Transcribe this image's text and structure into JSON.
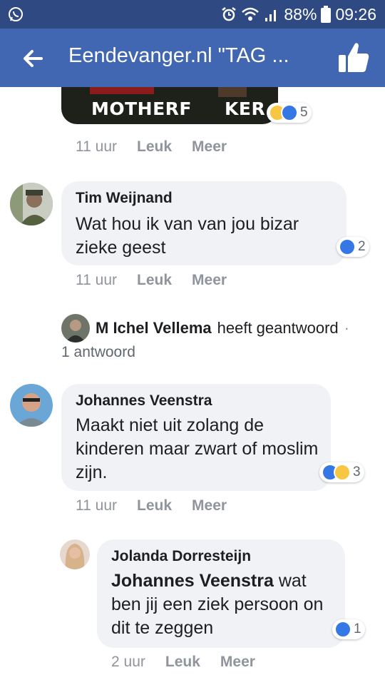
{
  "status_bar": {
    "battery": "88%",
    "time": "09:26",
    "icons": [
      "whatsapp-icon",
      "alarm-icon",
      "wifi-icon",
      "signal-icon",
      "battery-icon"
    ]
  },
  "header": {
    "title": "Eendevanger.nl \"TAG ...",
    "icons": [
      "back-arrow-icon",
      "like-page-icon"
    ]
  },
  "colors": {
    "header_bg": "#4267b2",
    "status_bg": "#2f4a82",
    "bubble_bg": "#f0f2f5",
    "like_blue": "#3578e5"
  },
  "gif": {
    "text": "MOTHERF     KER.",
    "reactions": {
      "icons": [
        "haha-icon",
        "like-icon"
      ],
      "count": "5"
    },
    "meta": {
      "time": "11 uur",
      "like": "Leuk",
      "more": "Meer"
    }
  },
  "comments": [
    {
      "author": "Tim Weijnand",
      "text": "Wat hou ik van van jou bizar zieke geest",
      "reactions": {
        "icons": [
          "like-icon"
        ],
        "count": "2"
      },
      "meta": {
        "time": "11 uur",
        "like": "Leuk",
        "more": "Meer"
      }
    },
    {
      "author": "Johannes Veenstra",
      "text": "Maakt niet uit zolang de kinderen maar zwart of moslim zijn.",
      "reactions": {
        "icons": [
          "like-icon",
          "wow-icon"
        ],
        "count": "3"
      },
      "meta": {
        "time": "11 uur",
        "like": "Leuk",
        "more": "Meer"
      }
    }
  ],
  "reply_preview": {
    "author": "M Ichel Vellema",
    "action": "heeft geantwoord",
    "separator": "·",
    "count": "1 antwoord"
  },
  "reply": {
    "author": "Jolanda Dorresteijn",
    "mention": "Johannes Veenstra",
    "text": " wat ben jij een ziek persoon on dit te zeggen",
    "reactions": {
      "icons": [
        "like-icon"
      ],
      "count": "1"
    },
    "meta": {
      "time": "2 uur",
      "like": "Leuk",
      "more": "Meer"
    }
  }
}
